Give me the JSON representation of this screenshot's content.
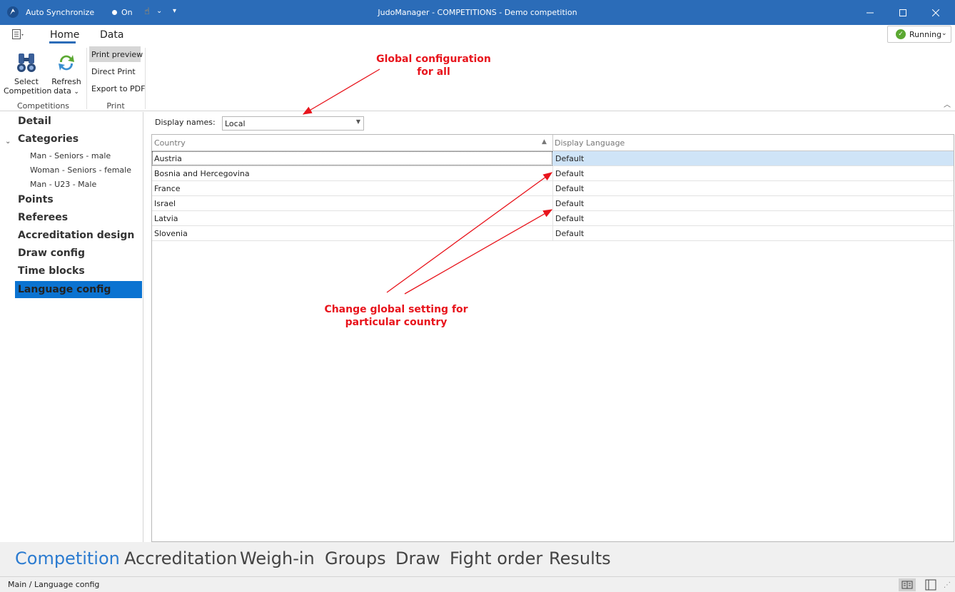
{
  "titlebar": {
    "sync_label": "Auto Synchronize",
    "on_label": "On",
    "title": "JudoManager - COMPETITIONS - Demo competition",
    "icons": [
      "app-logo-icon",
      "hand-pointer-icon",
      "chevron-down-icon",
      "minimize-icon",
      "maximize-icon",
      "close-icon"
    ]
  },
  "ribbon": {
    "tabs": [
      {
        "label": "Home"
      },
      {
        "label": "Data"
      }
    ],
    "status_button": "Running",
    "groups": {
      "competitions": {
        "label": "Competitions",
        "select_line1": "Select",
        "select_line2": "Competition",
        "refresh_line1": "Refresh",
        "refresh_line2": "data"
      },
      "print": {
        "label": "Print",
        "items": [
          "Print preview",
          "Direct Print",
          "Export to PDF"
        ]
      }
    }
  },
  "nav": {
    "items": [
      {
        "label": "Detail"
      },
      {
        "label": "Categories"
      },
      {
        "label": "Points"
      },
      {
        "label": "Referees"
      },
      {
        "label": "Accreditation design"
      },
      {
        "label": "Draw config"
      },
      {
        "label": "Time blocks"
      },
      {
        "label": "Language config"
      }
    ],
    "sub_items": [
      {
        "label": "Man - Seniors - male"
      },
      {
        "label": "Woman - Seniors - female"
      },
      {
        "label": "Man - U23 - Male"
      }
    ],
    "selected": "Language config"
  },
  "main": {
    "display_names_label": "Display names:",
    "display_names_value": "Local",
    "columns": [
      "Country",
      "Display Language"
    ],
    "rows": [
      {
        "country": "Austria",
        "language": "Default"
      },
      {
        "country": "Bosnia and Hercegovina",
        "language": "Default"
      },
      {
        "country": "France",
        "language": "Default"
      },
      {
        "country": "Israel",
        "language": "Default"
      },
      {
        "country": "Latvia",
        "language": "Default"
      },
      {
        "country": "Slovenia",
        "language": "Default"
      }
    ]
  },
  "annotations": {
    "global_line1": "Global configuration",
    "global_line2": "for all",
    "change_line1": "Change global setting for",
    "change_line2": "particular country",
    "color": "#e8141c"
  },
  "bottom_nav": [
    {
      "label": "Competition"
    },
    {
      "label": "Accreditation"
    },
    {
      "label": "Weigh-in"
    },
    {
      "label": "Groups"
    },
    {
      "label": "Draw"
    },
    {
      "label": "Fight order"
    },
    {
      "label": "Results"
    }
  ],
  "status": {
    "path": "Main / Language config"
  },
  "colors": {
    "titlebar": "#2b6cb8",
    "accent": "#2b7bd0",
    "selection": "#0b73d1"
  }
}
